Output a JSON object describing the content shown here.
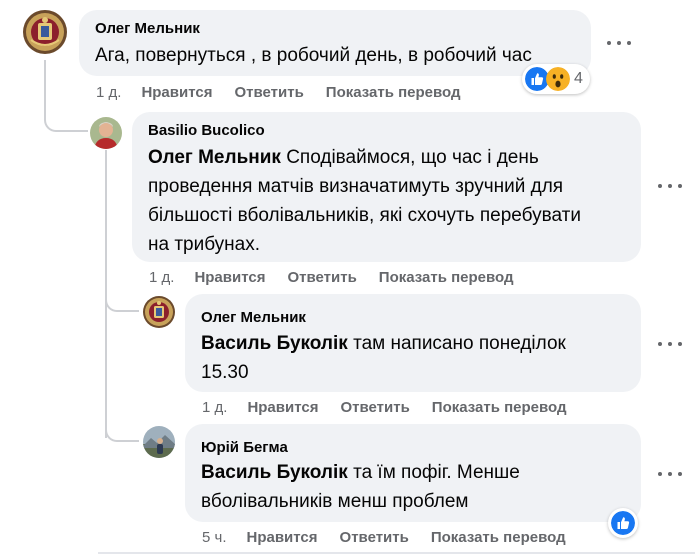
{
  "colors": {
    "bubble_bg": "#f0f2f5",
    "meta_text": "#65676b",
    "like_blue": "#1877f2",
    "wow_yellow": "#f7b125",
    "thread_line": "#ced0d4"
  },
  "comments": [
    {
      "author": "Олег Мельник",
      "avatar_icon": "emblem-avatar-icon",
      "text": "Ага, повернуться , в робочий день, в робочий час",
      "time": "1 д.",
      "actions": {
        "like": "Нравится",
        "reply": "Ответить",
        "translate": "Показать перевод"
      },
      "reactions": {
        "icons": [
          "like-icon",
          "wow-icon"
        ],
        "count": "4"
      }
    },
    {
      "author": "Basilio Bucolico",
      "avatar_icon": "person-avatar-icon",
      "mention": "Олег Мельник",
      "text_line1_rest": " Сподіваймося, що час і день",
      "text_line2": "проведення матчів визначатимуть зручний для",
      "text_line3": "більшості вболівальників, які схочуть перебувати",
      "text_line4": "на трибунах.",
      "time": "1 д.",
      "actions": {
        "like": "Нравится",
        "reply": "Ответить",
        "translate": "Показать перевод"
      }
    },
    {
      "author": "Олег Мельник",
      "avatar_icon": "emblem-avatar-icon",
      "mention": "Василь Буколік",
      "text_line1_rest": " там написано понеділок",
      "text_line2": "15.30",
      "time": "1 д.",
      "actions": {
        "like": "Нравится",
        "reply": "Ответить",
        "translate": "Показать перевод"
      }
    },
    {
      "author": "Юрій Бегма",
      "avatar_icon": "outdoor-photo-avatar-icon",
      "mention": "Василь Буколік",
      "text_line1_rest": " та їм пофіг. Менше",
      "text_line2": "вболівальників менш проблем",
      "time": "5 ч.",
      "actions": {
        "like": "Нравится",
        "reply": "Ответить",
        "translate": "Показать перевод"
      },
      "reactions": {
        "icons": [
          "like-icon"
        ]
      }
    }
  ]
}
